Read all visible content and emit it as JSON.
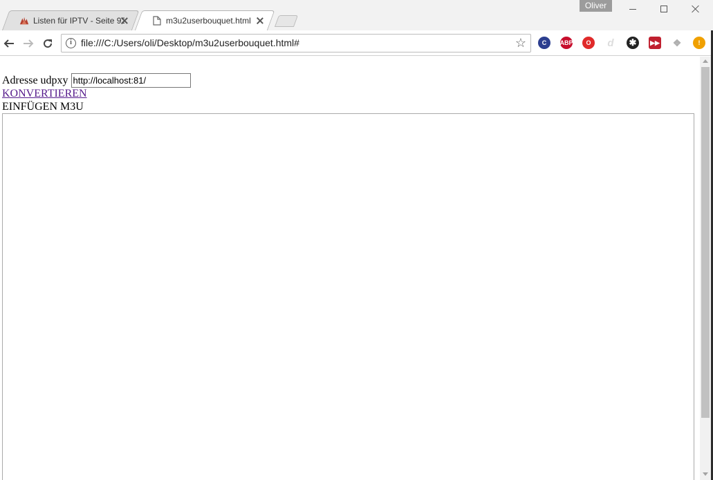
{
  "window": {
    "profile_name": "Oliver"
  },
  "tabs": [
    {
      "title": "Listen für IPTV - Seite 92",
      "favicon": "forum-favicon-icon",
      "active": false
    },
    {
      "title": "m3u2userbouquet.html",
      "favicon": "page-icon",
      "active": true
    }
  ],
  "toolbar": {
    "url": "file:///C:/Users/oli/Desktop/m3u2userbouquet.html#",
    "extensions": [
      {
        "name": "c-extension-icon",
        "label": "C",
        "color": "#2c3e8f"
      },
      {
        "name": "adblock-plus-icon",
        "label": "ABP",
        "color": "#c70d2c"
      },
      {
        "name": "opera-extension-icon",
        "label": "O",
        "color": "#e02a2a"
      },
      {
        "name": "d-extension-icon",
        "label": "d",
        "color": "#dddddd"
      },
      {
        "name": "gear-extension-icon",
        "label": "",
        "color": "#222222"
      },
      {
        "name": "play-extension-icon",
        "label": "",
        "color": "#c0202f"
      },
      {
        "name": "dropbox-icon",
        "label": "",
        "color": "#b0b0b0"
      },
      {
        "name": "alert-extension-icon",
        "label": "!",
        "color": "#f0a000"
      }
    ]
  },
  "page": {
    "udpxy_label": "Adresse udpxy",
    "udpxy_value": "http://localhost:81/",
    "convert_link": "KONVERTIEREN",
    "paste_label": "EINFÜGEN M3U",
    "m3u_value": ""
  }
}
